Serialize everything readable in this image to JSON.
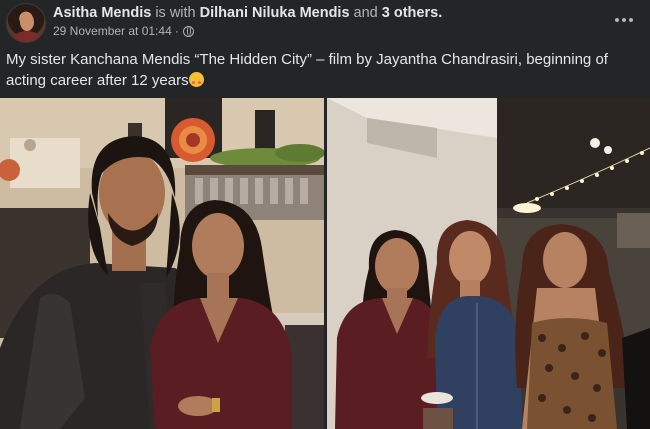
{
  "post": {
    "author": "Asitha Mendis",
    "with_text": "is with",
    "tagged": "Dilhani Niluka Mendis",
    "and_text": "and",
    "others": "3 others.",
    "timestamp": "29 November at 01:44",
    "separator": "·",
    "caption": "My sister Kanchana Mendis “The Hidden City” – film by Jayantha Chandrasiri, beginning of acting career after 12 years"
  },
  "icons": {
    "audience": "globe-icon",
    "menu": "more-horizontal-icon",
    "emoji": "smiling-face-with-hearts-icon"
  },
  "colors": {
    "background": "#242526",
    "primary_text": "#e4e6eb",
    "secondary_text": "#b0b3b8"
  }
}
